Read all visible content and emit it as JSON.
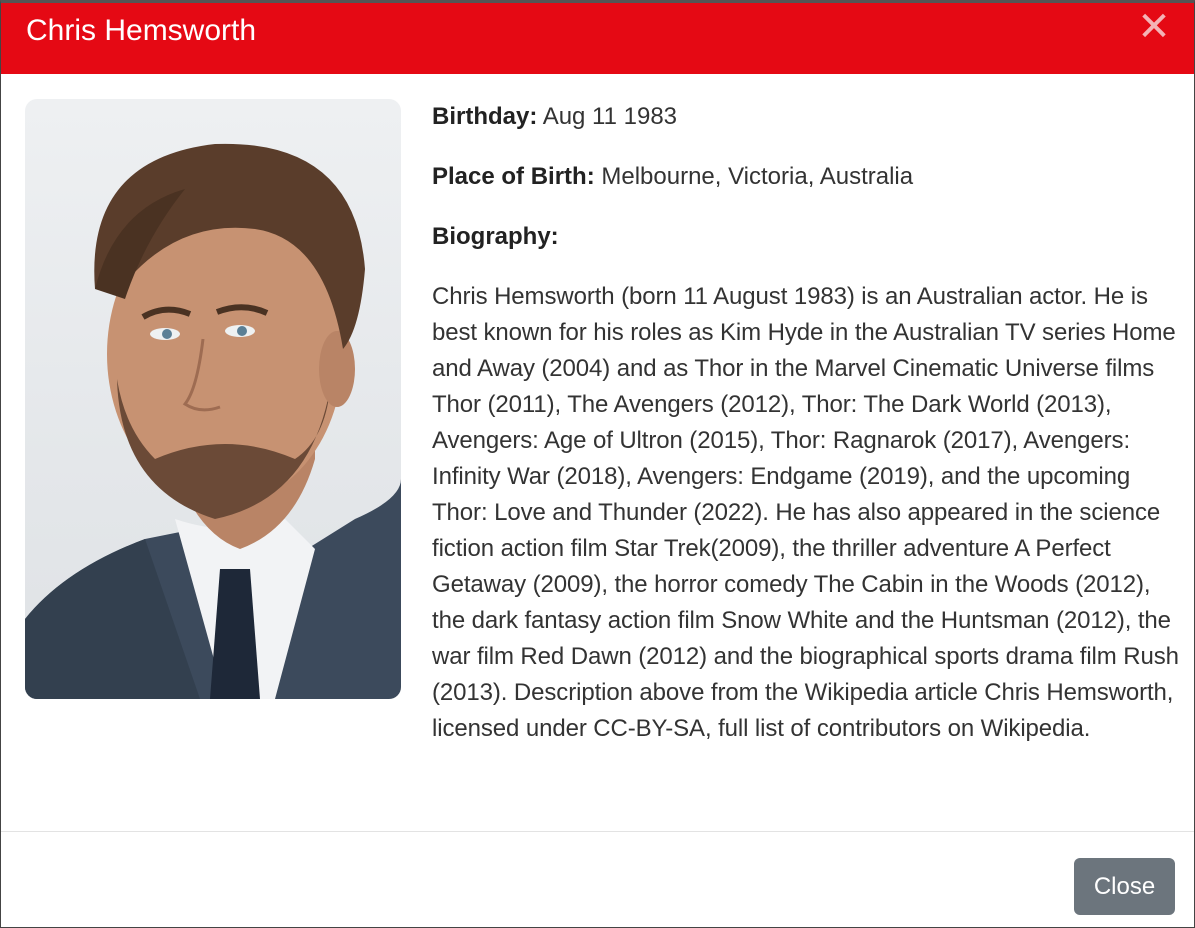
{
  "modal": {
    "title": "Chris Hemsworth",
    "close_icon": "close-icon",
    "close_glyph": "✕",
    "accent_color": "#e50914"
  },
  "person": {
    "photo_alt": "Chris Hemsworth",
    "birthday_label": "Birthday:",
    "birthday_value": " Aug 11 1983",
    "birthplace_label": "Place of Birth:",
    "birthplace_value": " Melbourne, Victoria, Australia",
    "biography_label": "Biography:",
    "biography": "Chris Hemsworth (born 11 August 1983) is an Australian actor. He is best known for his roles as Kim Hyde in the Australian TV series Home and Away (2004) and as Thor in the Marvel Cinematic Universe films Thor (2011), The Avengers (2012), Thor: The Dark World (2013), Avengers: Age of Ultron (2015), Thor: Ragnarok (2017), Avengers: Infinity War (2018), Avengers: Endgame (2019), and the upcoming Thor: Love and Thunder (2022). He has also appeared in the science fiction action film Star Trek(2009), the thriller adventure A Perfect Getaway (2009), the horror comedy The Cabin in the Woods (2012), the dark fantasy action film Snow White and the Huntsman (2012), the war film Red Dawn (2012) and the biographical sports drama film Rush (2013). Description above from the Wikipedia article Chris Hemsworth, licensed under CC-BY-SA, full list of contributors on Wikipedia."
  },
  "footer": {
    "close_label": "Close"
  }
}
